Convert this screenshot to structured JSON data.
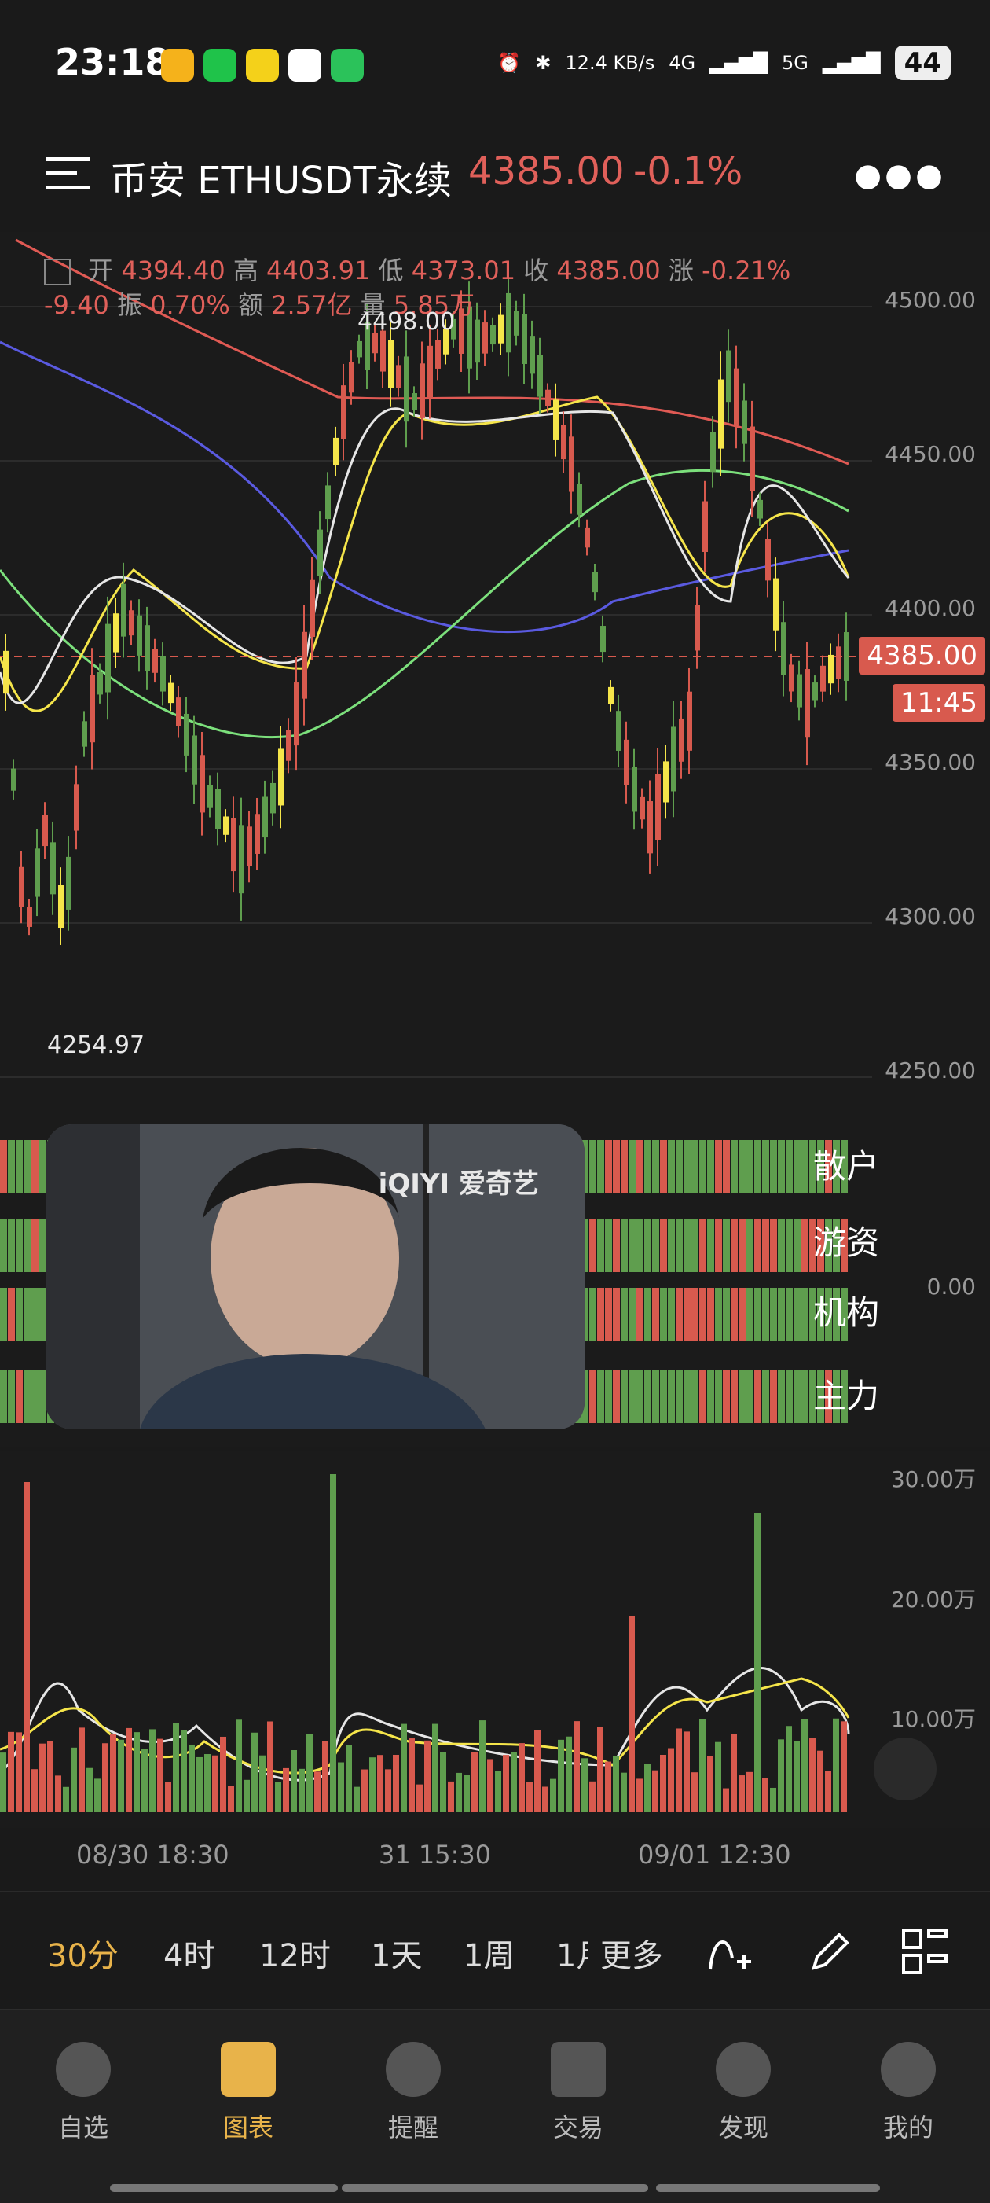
{
  "status_bar": {
    "time": "23:18",
    "net_speed": "12.4 KB/s",
    "net_type_1": "4G",
    "net_type_2": "5G",
    "battery": "44"
  },
  "header": {
    "title": "币安 ETHUSDT永续",
    "price": "4385.00",
    "change": "-0.1%"
  },
  "ohlc": {
    "open_label": "开",
    "open": "4394.40",
    "high_label": "高",
    "high": "4403.91",
    "low_label": "低",
    "low": "4373.01",
    "close_label": "收",
    "close": "4385.00",
    "chg_label": "涨",
    "chg": "-0.21%",
    "chg_abs": "-9.40",
    "amp_label": "振",
    "amp": "0.70%",
    "amt_label": "额",
    "amt": "2.57亿",
    "vol_label": "量",
    "vol": "5.85万"
  },
  "price_axis": [
    "4500.00",
    "4450.00",
    "4400.00",
    "4350.00",
    "4300.00",
    "4250.00"
  ],
  "current_price_tag": "4385.00",
  "countdown_tag": "11:45",
  "max_label": "4498.00",
  "min_label": "4254.97",
  "flow": {
    "labels": [
      "散户",
      "游资",
      "机构",
      "主力"
    ],
    "zero": "0.00"
  },
  "video": {
    "logo": "iQIYI 爱奇艺"
  },
  "volume_axis": [
    "30.00万",
    "20.00万",
    "10.00万"
  ],
  "time_axis": [
    "08/30 18:30",
    "31 15:30",
    "09/01 12:30"
  ],
  "periods": [
    "30分",
    "4时",
    "12时",
    "1天",
    "1周",
    "1月",
    "更多"
  ],
  "tabs": [
    "自选",
    "图表",
    "提醒",
    "交易",
    "发现",
    "我的"
  ],
  "colors": {
    "up": "#d85a4e",
    "down": "#5f9e4e",
    "accent": "#e8b34a"
  }
}
